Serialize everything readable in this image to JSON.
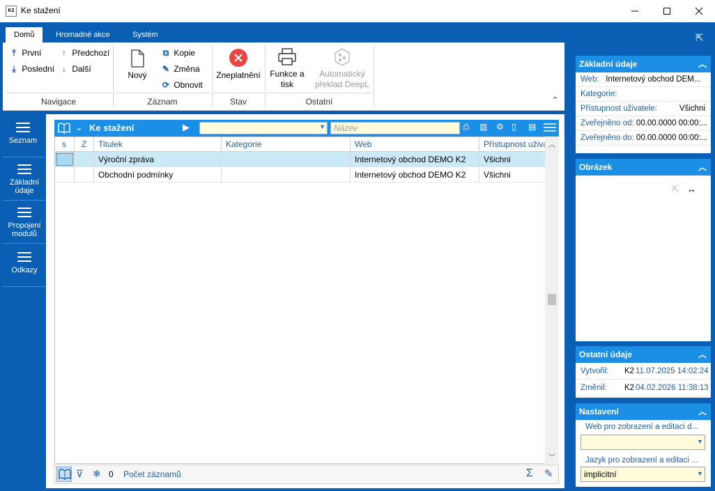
{
  "window": {
    "title": "Ke stažení",
    "app_icon_text": "K2"
  },
  "ribbon": {
    "tabs": [
      "Domů",
      "Hromadné akce",
      "Systém"
    ],
    "navigace": {
      "prvni": "První",
      "predchozi": "Předchozí",
      "posledni": "Poslední",
      "dalsi": "Další",
      "label": "Navigace"
    },
    "zaznam": {
      "novy": "Nový",
      "kopie": "Kopie",
      "zmena": "Změna",
      "obnovit": "Obnovit",
      "label": "Záznam"
    },
    "stav": {
      "zneplatneni": "Zneplatnění",
      "label": "Stav"
    },
    "ostatni": {
      "funkce_line1": "Funkce a",
      "funkce_line2": "tisk",
      "preklad_line1": "Automatický",
      "preklad_line2": "překlad DeepL",
      "label": "Ostatní"
    }
  },
  "leftnav": {
    "items": [
      {
        "label1": "Seznam",
        "label2": ""
      },
      {
        "label1": "Základní",
        "label2": "údaje"
      },
      {
        "label1": "Propojení",
        "label2": "modulů"
      },
      {
        "label1": "Odkazy",
        "label2": ""
      }
    ]
  },
  "grid": {
    "title": "Ke stažení",
    "filter_placeholder": "Název",
    "columns": [
      "s",
      "Z",
      "Titulek",
      "Kategorie",
      "Web",
      "Přístupnost uživa"
    ],
    "rows": [
      [
        "",
        "",
        "Výroční zpráva",
        "",
        "Internetový obchod DEMO K2",
        "Všichni"
      ],
      [
        "",
        "",
        "Obchodní podmínky",
        "",
        "Internetový obchod DEMO K2",
        "Všichni"
      ]
    ],
    "footer": {
      "count": "0",
      "count_label": "Počet záznamů"
    }
  },
  "right": {
    "zakladni": {
      "title": "Základní údaje",
      "web_label": "Web:",
      "web_value": "Internetový obchod DEM...",
      "kategorie_label": "Kategorie:",
      "pristupnost_label": "Přístupnost uživatele:",
      "pristupnost_value": "Všichni",
      "od_label": "Zveřejněno od:",
      "od_value": "00.00.0000 00:00:...",
      "do_label": "Zveřejněno do:",
      "do_value": "00.00.0000 00:00:..."
    },
    "obrazek": {
      "title": "Obrázek"
    },
    "ostatni": {
      "title": "Ostatní údaje",
      "vytvoril_label": "Vytvořil:",
      "vytvoril_user": "K2",
      "vytvoril_date": "11.07.2025 14:02:24",
      "zmenil_label": "Změnil:",
      "zmenil_user": "K2",
      "zmenil_date": "04.02.2026 11:38:13"
    },
    "nastaveni": {
      "title": "Nastavení",
      "web_label": "Web pro zobrazení a editaci d...",
      "web_value": "",
      "jazyk_label": "Jazyk pro zobrazení a editaci ...",
      "jazyk_value": "implicitní"
    }
  },
  "colors": {
    "frame_blue": "#0a5fb4",
    "header_blue": "#1b8ee6",
    "selected_row": "#cbe8f6",
    "input_yellow": "#fffbdb",
    "cancel_red": "#e84545"
  }
}
